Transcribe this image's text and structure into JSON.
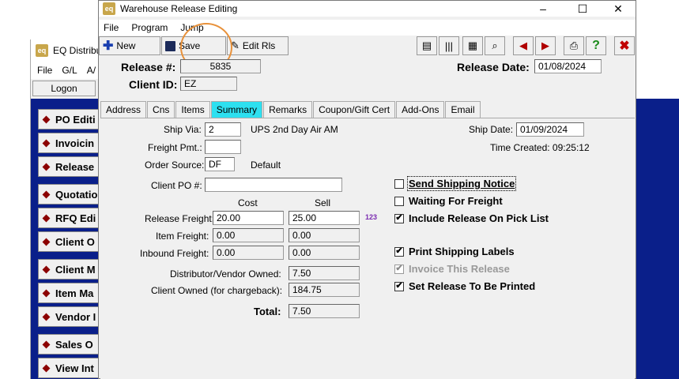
{
  "bg_window": {
    "logo": "eq",
    "title": "EQ Distributi",
    "menu": [
      "File",
      "G/L",
      "A/"
    ],
    "logon_label": "Logon",
    "buttons": [
      "PO Editi",
      "Invoicin",
      "Release",
      "Quotatio",
      "RFQ Edi",
      "Client O",
      "Client M",
      "Item Ma",
      "Vendor I",
      "Sales O",
      "View Int"
    ]
  },
  "window": {
    "logo": "eq",
    "title": "Warehouse Release Editing",
    "minimize": "–",
    "maximize": "☐",
    "close": "✕"
  },
  "menu": [
    "File",
    "Program",
    "Jump"
  ],
  "toolbar": {
    "new_label": "New",
    "save_label": "Save",
    "edit_label": "Edit Rls"
  },
  "header": {
    "release_label": "Release #:",
    "release_value": "5835",
    "client_label": "Client ID:",
    "client_value": "EZ",
    "release_date_label": "Release Date:",
    "release_date_value": "01/08/2024"
  },
  "tabs": [
    "Address",
    "Cns",
    "Items",
    "Summary",
    "Remarks",
    "Coupon/Gift Cert",
    "Add-Ons",
    "Email"
  ],
  "active_tab": "Summary",
  "summary": {
    "ship_via_label": "Ship Via:",
    "ship_via_code": "2",
    "ship_via_desc": "UPS 2nd Day Air AM",
    "freight_pmt_label": "Freight Pmt.:",
    "freight_pmt_value": "",
    "order_source_label": "Order Source:",
    "order_source_code": "DF",
    "order_source_desc": "Default",
    "client_po_label": "Client PO #:",
    "client_po_value": "",
    "ship_date_label": "Ship Date:",
    "ship_date_value": "01/09/2024",
    "time_created": "Time Created: 09:25:12",
    "cost_header": "Cost",
    "sell_header": "Sell",
    "release_freight_label": "Release Freight:",
    "release_freight_cost": "20.00",
    "release_freight_sell": "25.00",
    "calc_icon_text": "123",
    "item_freight_label": "Item Freight:",
    "item_freight_cost": "0.00",
    "item_freight_sell": "0.00",
    "inbound_freight_label": "Inbound Freight:",
    "inbound_freight_cost": "0.00",
    "inbound_freight_sell": "0.00",
    "dist_owned_label": "Distributor/Vendor Owned:",
    "dist_owned_value": "7.50",
    "client_owned_label": "Client Owned (for chargeback):",
    "client_owned_value": "184.75",
    "total_label": "Total:",
    "total_value": "7.50"
  },
  "checkboxes": [
    {
      "label": "Send Shipping Notice",
      "checked": false,
      "disabled": false
    },
    {
      "label": "Waiting For Freight",
      "checked": false,
      "disabled": false
    },
    {
      "label": "Include Release On Pick List",
      "checked": true,
      "disabled": false
    },
    {
      "label": "Print Shipping Labels",
      "checked": true,
      "disabled": false
    },
    {
      "label": "Invoice This Release",
      "checked": true,
      "disabled": true
    },
    {
      "label": "Set Release To Be Printed",
      "checked": true,
      "disabled": false
    }
  ],
  "colors": {
    "active_tab": "#2de0f0",
    "background_blue": "#0a1f8a",
    "highlight_circle": "#e8913a"
  }
}
